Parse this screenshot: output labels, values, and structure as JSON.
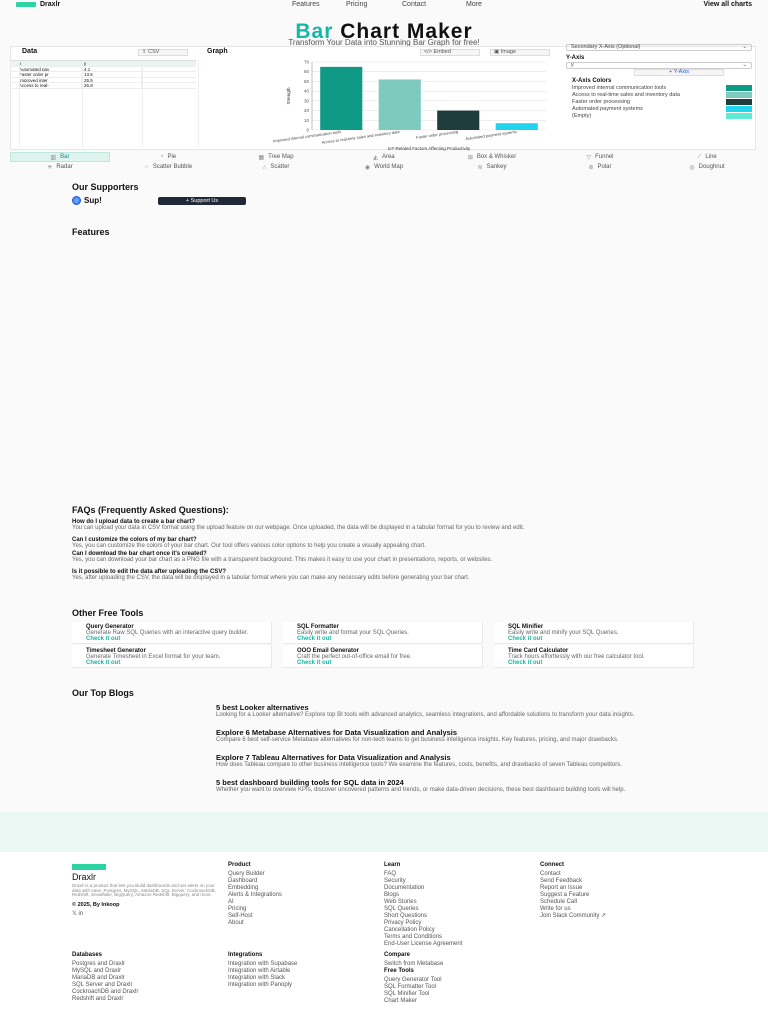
{
  "nav": {
    "brand": "Draxlr",
    "items": [
      "Features",
      "Pricing",
      "Contact",
      "More"
    ],
    "right": "View all charts"
  },
  "hero": {
    "title_accent": "Bar",
    "title_rest": "Chart Maker",
    "subtitle": "Transform Your Data into Stunning Bar Graph for free!"
  },
  "editor": {
    "data_title": "Data",
    "csv_label": "CSV",
    "graph_title": "Graph",
    "embed_label": "</> Embed",
    "image_label": "Image",
    "columns": [
      "x",
      "y"
    ],
    "rows": [
      {
        "x": "Automated pay",
        "y": "4.1"
      },
      {
        "x": "Faster order pr",
        "y": "13.5"
      },
      {
        "x": "Improved inter",
        "y": "25.5"
      },
      {
        "x": "Access to real-",
        "y": "26.8"
      }
    ],
    "secondary_axis_label": "Secondary X-Axis (Optional)",
    "y_axis_title": "Y-Axis",
    "y_axis_select": "y",
    "y_axis_chip": "+ Y-Axis",
    "x_colors_title": "X-Axis Colors",
    "x_colors": [
      {
        "label": "Improved internal communication tools",
        "color": "#0f9a86"
      },
      {
        "label": "Access to real-time sales and inventory data",
        "color": "#7fcabf"
      },
      {
        "label": "Faster order processing",
        "color": "#1f3d3c"
      },
      {
        "label": "Automated payment systems",
        "color": "#22d3ee"
      },
      {
        "label": "(Empty)",
        "color": "#5eead4"
      }
    ]
  },
  "chart_data": {
    "type": "bar",
    "categories": [
      "Improved internal communication tools",
      "Access to real-time sales and inventory data",
      "Faster order processing",
      "Automated payment systems"
    ],
    "values": [
      65,
      52,
      20,
      7
    ],
    "colors": [
      "#0f9a86",
      "#7fcabf",
      "#1f3d3c",
      "#22d3ee"
    ],
    "ylim": [
      0,
      70
    ],
    "yticks": [
      0,
      10,
      20,
      30,
      40,
      50,
      60,
      70
    ],
    "ylabel": "Strength",
    "xlabel": "IoT-Related Factors Affecting Productivity"
  },
  "chart_types": [
    {
      "label": "Bar",
      "icon": "▥"
    },
    {
      "label": "Pie",
      "icon": "◔"
    },
    {
      "label": "Tree Map",
      "icon": "▦"
    },
    {
      "label": "Area",
      "icon": "◭"
    },
    {
      "label": "Box & Whisker",
      "icon": "⊞"
    },
    {
      "label": "Funnel",
      "icon": "▽"
    },
    {
      "label": "Line",
      "icon": "⟋"
    },
    {
      "label": "Radar",
      "icon": "✳"
    },
    {
      "label": "Scatter Bubble",
      "icon": "⁘"
    },
    {
      "label": "Scatter",
      "icon": "∴"
    },
    {
      "label": "World Map",
      "icon": "◉"
    },
    {
      "label": "Sankey",
      "icon": "≋"
    },
    {
      "label": "Polar",
      "icon": "⊛"
    },
    {
      "label": "Doughnut",
      "icon": "◎"
    }
  ],
  "supporters": {
    "title": "Our Supporters",
    "sponsor": "Sup!",
    "support_button": "+ Support Us"
  },
  "features_title": "Features",
  "faqs": {
    "title": "FAQs (Frequently Asked Questions):",
    "items": [
      {
        "q": "How do I upload data to create a bar chart?",
        "a": "You can upload your data in CSV format using the upload feature on our webpage. Once uploaded, the data will be displayed in a tabular format for you to review and edit."
      },
      {
        "q": "Can I customize the colors of my bar chart?",
        "a": "Yes, you can customize the colors of your bar chart. Our tool offers various color options to help you create a visually appealing chart."
      },
      {
        "q": "Can I download the bar chart once it's created?",
        "a": "Yes, you can download your bar chart as a PNG file with a transparent background. This makes it easy to use your chart in presentations, reports, or websites."
      },
      {
        "q": "Is it possible to edit the data after uploading the CSV?",
        "a": "Yes, after uploading the CSV, the data will be displayed in a tabular format where you can make any necessary edits before generating your bar chart."
      }
    ]
  },
  "tools": {
    "title": "Other Free Tools",
    "link_label": "Check it out",
    "items": [
      {
        "t": "Query Generator",
        "d": "Generate Raw SQL Queries with an interactive query builder."
      },
      {
        "t": "SQL Formatter",
        "d": "Easily write and format your SQL Queries."
      },
      {
        "t": "SQL Minifier",
        "d": "Easily write and minify your SQL Queries."
      },
      {
        "t": "Timesheet Generator",
        "d": "Generate Timesheet in Excel format for your team."
      },
      {
        "t": "OOO Email Generator",
        "d": "Craft the perfect out-of-office email for free."
      },
      {
        "t": "Time Card Calculator",
        "d": "Track hours effortlessly with our free calculator tool."
      }
    ]
  },
  "blogs": {
    "title": "Our Top Blogs",
    "items": [
      {
        "t": "5 best Looker alternatives",
        "d": "Looking for a Looker alternative? Explore top BI tools with advanced analytics, seamless integrations, and affordable solutions to transform your data insights."
      },
      {
        "t": "Explore 6 Metabase Alternatives for Data Visualization and Analysis",
        "d": "Compare 6 best self-service Metabase alternatives for non-tech teams to get business intelligence insights. Key features, pricing, and major drawbacks."
      },
      {
        "t": "Explore 7 Tableau Alternatives for Data Visualization and Analysis",
        "d": "How does Tableau compare to other business intelligence tools? We examine the features, costs, benefits, and drawbacks of seven Tableau competitors."
      },
      {
        "t": "5 best dashboard building tools for SQL data in 2024",
        "d": "Whether you want to overview KPIs, discover uncovered patterns and trends, or make data-driven decisions, these best dashboard building tools will help."
      }
    ]
  },
  "footer": {
    "brand": "Draxlr",
    "desc": "Draxlr is a product that lets you Build dashboards and set alerts on your data with ease. Postgres, MySQL, MariaDB, SQL Server, CockroachDB, Redshift, Snowflake, BigQuery, Amazon Redshift, Bigquery, and more.",
    "copyright": "© 2025, By Inkoop",
    "social": "𝕏  in",
    "columns": [
      {
        "h": "Product",
        "items": [
          "Query Builder",
          "Dashboard",
          "Embedding",
          "Alerts & Integrations",
          "AI",
          "Pricing",
          "Self-Host",
          "About"
        ]
      },
      {
        "h": "Learn",
        "items": [
          "FAQ",
          "Security",
          "Documentation",
          "Blogs",
          "Web Stories",
          "SQL Queries",
          "Short Questions",
          "Privacy Policy",
          "Cancellation Policy",
          "Terms and Conditions",
          "End-User License Agreement"
        ]
      },
      {
        "h": "Connect",
        "items": [
          "Contact",
          "Send Feedback",
          "Report an Issue",
          "Suggest a Feature",
          "Schedule Call",
          "Write for us",
          "Join Slack Community ↗"
        ]
      },
      {
        "h": "Databases",
        "items": [
          "Postgres and Draxlr",
          "MySQL and Draxlr",
          "MariaDB and Draxlr",
          "SQL Server and Draxlr",
          "CockroachDB and Draxlr",
          "Redshift and Draxlr"
        ]
      },
      {
        "h": "Integrations",
        "items": [
          "Integration with Supabase",
          "Integration with Airtable",
          "Integration with Slack",
          "Integration with Panoply"
        ]
      },
      {
        "h": "Compare",
        "items": [
          "Switch from Metabase"
        ]
      },
      {
        "h": "Free Tools",
        "items": [
          "Query Generator Tool",
          "SQL Formatter Tool",
          "SQL Minifier Tool",
          "Chart Maker"
        ]
      }
    ]
  }
}
